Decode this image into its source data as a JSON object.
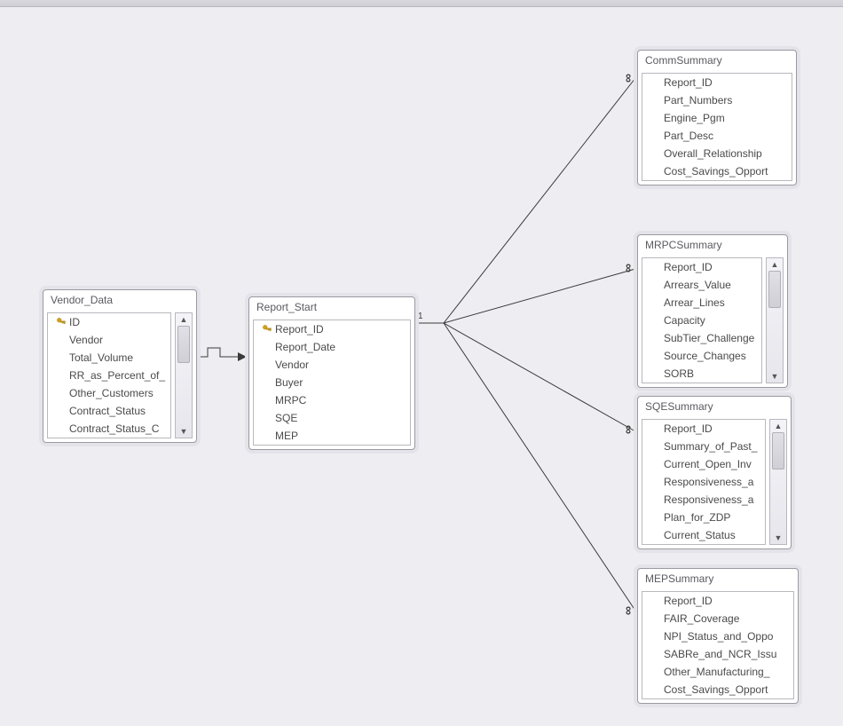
{
  "tables": {
    "vendor_data": {
      "title": "Vendor_Data",
      "fields": [
        {
          "name": "ID",
          "key": true
        },
        {
          "name": "Vendor"
        },
        {
          "name": "Total_Volume"
        },
        {
          "name": "RR_as_Percent_of_"
        },
        {
          "name": "Other_Customers"
        },
        {
          "name": "Contract_Status"
        },
        {
          "name": "Contract_Status_C"
        }
      ],
      "scrollbar": true
    },
    "report_start": {
      "title": "Report_Start",
      "fields": [
        {
          "name": "Report_ID",
          "key": true
        },
        {
          "name": "Report_Date"
        },
        {
          "name": "Vendor"
        },
        {
          "name": "Buyer"
        },
        {
          "name": "MRPC"
        },
        {
          "name": "SQE"
        },
        {
          "name": "MEP"
        }
      ],
      "scrollbar": false
    },
    "comm_summary": {
      "title": "CommSummary",
      "fields": [
        {
          "name": "Report_ID"
        },
        {
          "name": "Part_Numbers"
        },
        {
          "name": "Engine_Pgm"
        },
        {
          "name": "Part_Desc"
        },
        {
          "name": "Overall_Relationship"
        },
        {
          "name": "Cost_Savings_Opport"
        }
      ],
      "scrollbar": false
    },
    "mrpc_summary": {
      "title": "MRPCSummary",
      "fields": [
        {
          "name": "Report_ID"
        },
        {
          "name": "Arrears_Value"
        },
        {
          "name": "Arrear_Lines"
        },
        {
          "name": "Capacity"
        },
        {
          "name": "SubTier_Challenge"
        },
        {
          "name": "Source_Changes"
        },
        {
          "name": "SORB"
        }
      ],
      "scrollbar": true
    },
    "sqe_summary": {
      "title": "SQESummary",
      "fields": [
        {
          "name": "Report_ID"
        },
        {
          "name": "Summary_of_Past_"
        },
        {
          "name": "Current_Open_Inv"
        },
        {
          "name": "Responsiveness_a"
        },
        {
          "name": "Responsiveness_a"
        },
        {
          "name": "Plan_for_ZDP"
        },
        {
          "name": "Current_Status"
        }
      ],
      "scrollbar": true
    },
    "mep_summary": {
      "title": "MEPSummary",
      "fields": [
        {
          "name": "Report_ID"
        },
        {
          "name": "FAIR_Coverage"
        },
        {
          "name": "NPI_Status_and_Oppo"
        },
        {
          "name": "SABRe_and_NCR_Issu"
        },
        {
          "name": "Other_Manufacturing_"
        },
        {
          "name": "Cost_Savings_Opport"
        }
      ],
      "scrollbar": false
    }
  },
  "relations": {
    "one_label": "1",
    "many_label": "∞"
  }
}
